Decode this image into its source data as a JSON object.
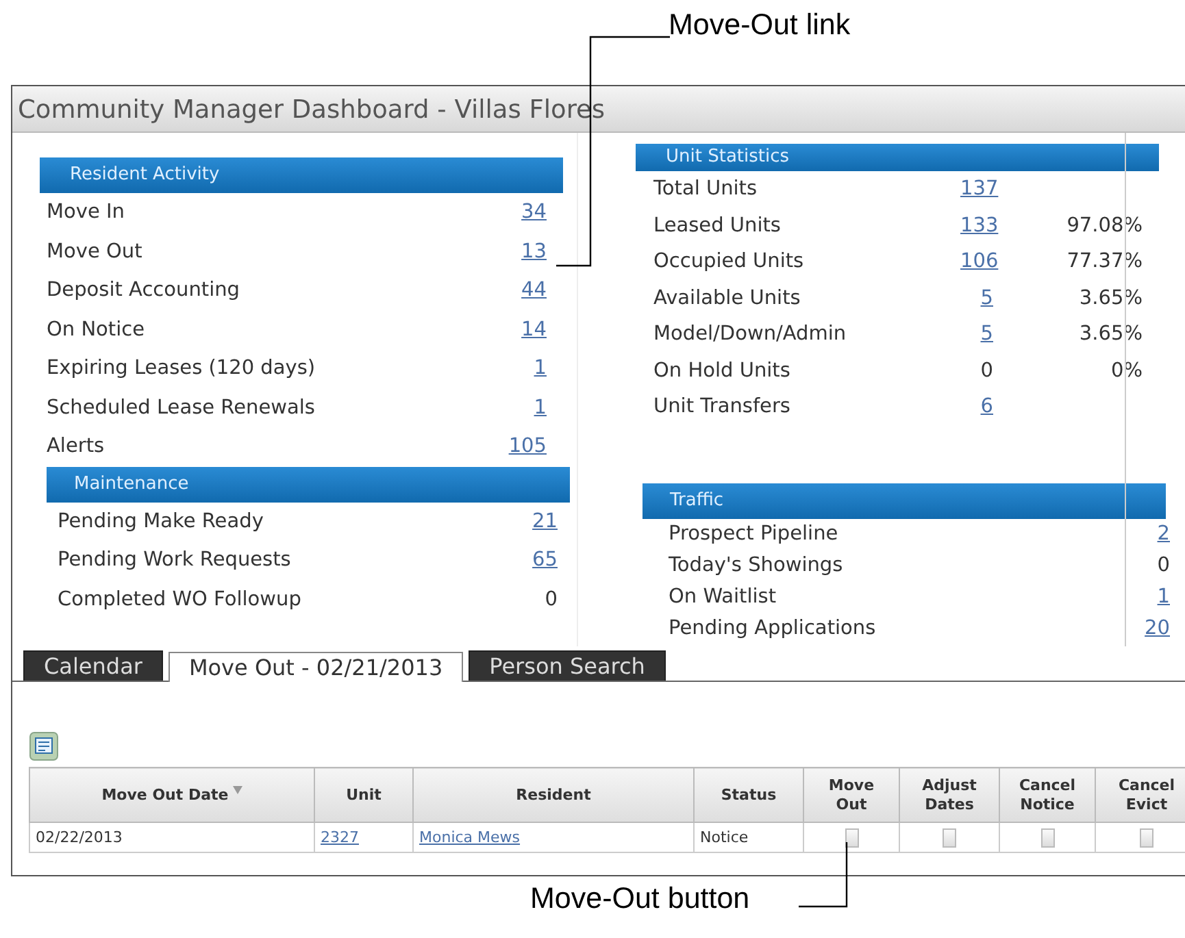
{
  "callouts": [
    {
      "kind": "top",
      "text": "Move-Out link"
    },
    {
      "kind": "bottom",
      "text": "Move-Out button"
    }
  ],
  "window": {
    "title": "Community Manager Dashboard - Villas Flores"
  },
  "resident_activity": {
    "title": "Resident Activity",
    "rows": [
      {
        "label": "Move In",
        "value": "34",
        "link": true
      },
      {
        "label": "Move Out",
        "value": "13",
        "link": true
      },
      {
        "label": "Deposit Accounting",
        "value": "44",
        "link": true
      },
      {
        "label": "On Notice",
        "value": "14",
        "link": true
      },
      {
        "label": "Expiring Leases (120 days)",
        "value": "1",
        "link": true
      },
      {
        "label": "Scheduled Lease Renewals",
        "value": "1",
        "link": true
      },
      {
        "label": "Alerts",
        "value": "105",
        "link": true
      }
    ]
  },
  "maintenance": {
    "title": "Maintenance",
    "rows": [
      {
        "label": "Pending Make Ready",
        "value": "21",
        "link": true
      },
      {
        "label": "Pending Work Requests",
        "value": "65",
        "link": true
      },
      {
        "label": "Completed WO Followup",
        "value": "0",
        "link": false
      }
    ]
  },
  "unit_statistics": {
    "title": "Unit Statistics",
    "rows": [
      {
        "label": "Total Units",
        "value": "137",
        "link": true
      },
      {
        "label": "Leased Units",
        "value": "133",
        "link": true,
        "percent": "97.08%"
      },
      {
        "label": "Occupied Units",
        "value": "106",
        "link": true,
        "percent": "77.37%"
      },
      {
        "label": "Available Units",
        "value": "5",
        "link": true,
        "percent": "3.65%"
      },
      {
        "label": "Model/Down/Admin",
        "value": "5",
        "link": true,
        "percent": "3.65%"
      },
      {
        "label": "On Hold Units",
        "value": "0",
        "link": false,
        "percent": "0%"
      },
      {
        "label": "Unit Transfers",
        "value": "6",
        "link": true
      }
    ]
  },
  "traffic": {
    "title": "Traffic",
    "rows": [
      {
        "label": "Prospect Pipeline",
        "value": "2",
        "link": true
      },
      {
        "label": "Today's Showings",
        "value": "0",
        "link": false
      },
      {
        "label": "On Waitlist",
        "value": "1",
        "link": true
      },
      {
        "label": "Pending Applications",
        "value": "20",
        "link": true
      }
    ]
  },
  "tabs": [
    {
      "label": "Calendar",
      "selected": false
    },
    {
      "label": "Move Out - 02/21/2013",
      "selected": true
    },
    {
      "label": "Person Search",
      "selected": false
    }
  ],
  "table": {
    "columns": [
      {
        "label": "Move Out Date",
        "sorted": true
      },
      {
        "label": "Unit",
        "sorted": false
      },
      {
        "label": "Resident",
        "sorted": false
      },
      {
        "label": "Status",
        "sorted": false
      },
      {
        "label": "Move Out",
        "sorted": false
      },
      {
        "label": "Adjust Dates",
        "sorted": false
      },
      {
        "label": "Cancel Notice",
        "sorted": false
      },
      {
        "label": "Cancel Evict",
        "sorted": false
      }
    ],
    "rows": [
      {
        "date": "02/22/2013",
        "unit": "2327",
        "resident": "Monica Mews",
        "status": "Notice"
      }
    ]
  }
}
